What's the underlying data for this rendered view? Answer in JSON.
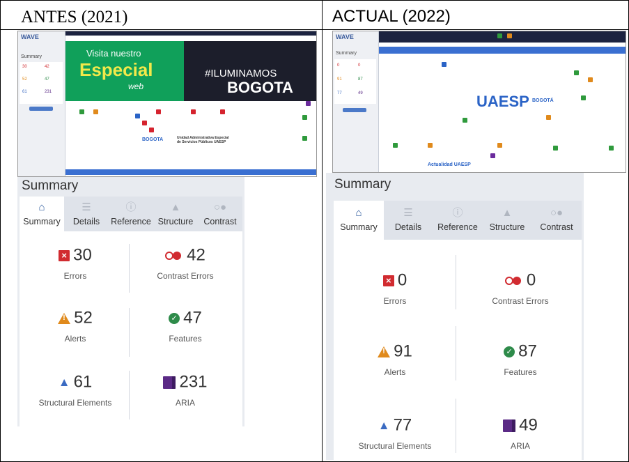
{
  "columns": {
    "before": {
      "title": "ANTES (2021)"
    },
    "after": {
      "title": "ACTUAL (2022)"
    }
  },
  "thumb_before": {
    "wave_logo": "WAVE",
    "banner_line1": "Visita nuestro",
    "banner_line2": "Especial",
    "banner_line3": "web",
    "banner_hash": "#ILUMINAMOS",
    "banner_city": "BOGOTA",
    "org_name": "Unidad Administrativa Especial de Servicios Públicos UAESP",
    "mini": {
      "title": "Summary",
      "e": "30",
      "c": "42",
      "a": "52",
      "f": "47",
      "s": "61",
      "r": "231"
    }
  },
  "thumb_after": {
    "wave_logo": "WAVE",
    "brand": "UAESP",
    "city": "BOGOTÁ",
    "section": "Actualidad UAESP",
    "mini": {
      "title": "Summary",
      "e": "0",
      "c": "0",
      "a": "91",
      "f": "87",
      "s": "77",
      "r": "49"
    }
  },
  "summary_before": {
    "title": "Summary",
    "tabs": [
      "Summary",
      "Details",
      "Reference",
      "Structure",
      "Contrast"
    ],
    "errors": {
      "value": "30",
      "label": "Errors"
    },
    "contrast": {
      "value": "42",
      "label": "Contrast Errors"
    },
    "alerts": {
      "value": "52",
      "label": "Alerts"
    },
    "features": {
      "value": "47",
      "label": "Features"
    },
    "structural": {
      "value": "61",
      "label": "Structural Elements"
    },
    "aria": {
      "value": "231",
      "label": "ARIA"
    }
  },
  "summary_after": {
    "title": "Summary",
    "tabs": [
      "Summary",
      "Details",
      "Reference",
      "Structure",
      "Contrast"
    ],
    "errors": {
      "value": "0",
      "label": "Errors"
    },
    "contrast": {
      "value": "0",
      "label": "Contrast Errors"
    },
    "alerts": {
      "value": "91",
      "label": "Alerts"
    },
    "features": {
      "value": "87",
      "label": "Features"
    },
    "structural": {
      "value": "77",
      "label": "Structural Elements"
    },
    "aria": {
      "value": "49",
      "label": "ARIA"
    }
  },
  "icons": {
    "summary": "home-icon",
    "details": "list-icon",
    "reference": "info-icon",
    "structure": "hierarchy-icon",
    "contrast": "contrast-icon"
  },
  "colors": {
    "error": "#d12b30",
    "alert": "#e08a1c",
    "feature": "#2e8b4a",
    "structure": "#3b6bc2",
    "aria": "#5b2a86",
    "banner_green": "#10a05a"
  }
}
